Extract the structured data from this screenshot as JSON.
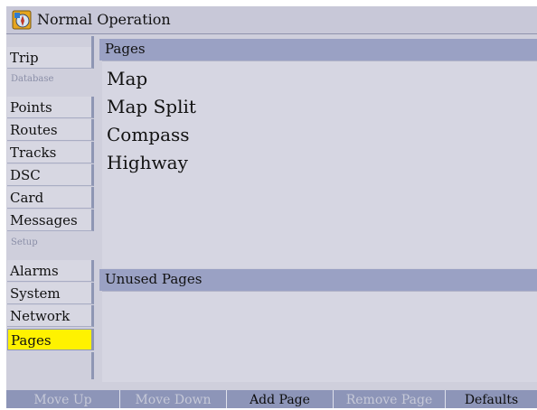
{
  "window": {
    "title": "Normal Operation",
    "icon": "compass-dial-icon"
  },
  "sidebar": {
    "items": [
      {
        "label": "Trip",
        "type": "tab"
      },
      {
        "label": "Database",
        "type": "section"
      },
      {
        "label": "Points",
        "type": "tab"
      },
      {
        "label": "Routes",
        "type": "tab"
      },
      {
        "label": "Tracks",
        "type": "tab"
      },
      {
        "label": "DSC",
        "type": "tab"
      },
      {
        "label": "Card",
        "type": "tab"
      },
      {
        "label": "Messages",
        "type": "tab"
      },
      {
        "label": "Setup",
        "type": "section"
      },
      {
        "label": "Alarms",
        "type": "tab"
      },
      {
        "label": "System",
        "type": "tab"
      },
      {
        "label": "Network",
        "type": "tab"
      },
      {
        "label": "Pages",
        "type": "tab",
        "selected": true
      }
    ]
  },
  "pages_panel": {
    "header": "Pages",
    "items": [
      "Map",
      "Map Split",
      "Compass",
      "Highway"
    ]
  },
  "unused_panel": {
    "header": "Unused Pages",
    "items": []
  },
  "buttons": [
    {
      "label": "Move Up",
      "enabled": false
    },
    {
      "label": "Move Down",
      "enabled": false
    },
    {
      "label": "Add Page",
      "enabled": true
    },
    {
      "label": "Remove Page",
      "enabled": false
    },
    {
      "label": "Defaults",
      "enabled": true
    }
  ],
  "colors": {
    "selected_tab": "#fff200",
    "panel_header": "#9aa1c4",
    "background": "#cfcfdc",
    "button_bar": "#8d95b8"
  }
}
